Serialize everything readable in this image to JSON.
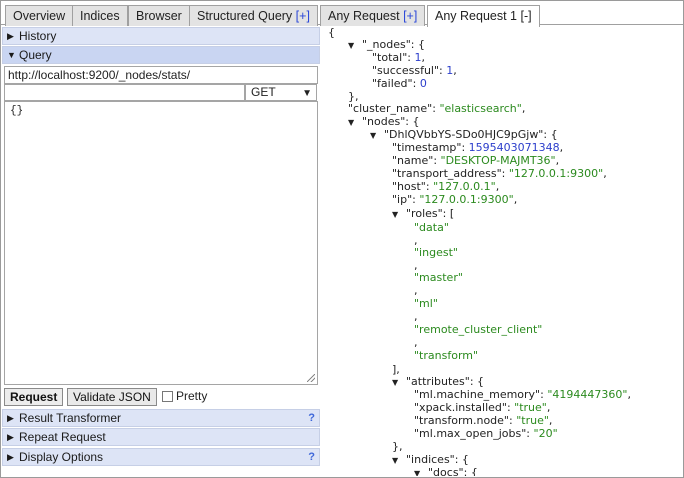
{
  "tabs": [
    {
      "label": "Overview",
      "plus": ""
    },
    {
      "label": "Indices",
      "plus": ""
    },
    {
      "label": "Browser",
      "plus": ""
    },
    {
      "label": "Structured Query",
      "plus": "[+]"
    },
    {
      "label": "Any Request",
      "plus": "[+]"
    },
    {
      "label": "Any Request 1",
      "plus": "[-]"
    }
  ],
  "left": {
    "history_label": "History",
    "query_label": "Query",
    "url_value": "http://localhost:9200/_nodes/stats/",
    "path_value": "",
    "method_value": "GET",
    "body_value": "{}",
    "request_button": "Request",
    "validate_button": "Validate JSON",
    "pretty_label": "Pretty",
    "sections": [
      {
        "label": "Result Transformer",
        "help": "?"
      },
      {
        "label": "Repeat Request",
        "help": ""
      },
      {
        "label": "Display Options",
        "help": "?"
      }
    ]
  },
  "json": {
    "open_brace": "{",
    "nodes_key": "\"_nodes\": {",
    "total_key": "\"total\": ",
    "total_val": "1",
    "successful_key": "\"successful\": ",
    "successful_val": "1",
    "failed_key": "\"failed\": ",
    "failed_val": "0",
    "close_obj": "},",
    "cluster_key": "\"cluster_name\": ",
    "cluster_val": "\"elasticsearch\"",
    "nodes2_key": "\"nodes\": {",
    "node_id_key": "\"DhlQVbbYS-SDo0HJC9pGjw\": {",
    "timestamp_key": "\"timestamp\": ",
    "timestamp_val": "1595403071348",
    "name_key": "\"name\": ",
    "name_val": "\"DESKTOP-MAJMT36\"",
    "transport_key": "\"transport_address\": ",
    "transport_val": "\"127.0.0.1:9300\"",
    "host_key": "\"host\": ",
    "host_val": "\"127.0.0.1\"",
    "ip_key": "\"ip\": ",
    "ip_val": "\"127.0.0.1:9300\"",
    "roles_key": "\"roles\": [",
    "roles": [
      "\"data\"",
      "\"ingest\"",
      "\"master\"",
      "\"ml\"",
      "\"remote_cluster_client\"",
      "\"transform\""
    ],
    "comma": ",",
    "close_arr": "],",
    "attributes_key": "\"attributes\": {",
    "mm_key": "\"ml.machine_memory\": ",
    "mm_val": "\"4194447360\"",
    "xpack_key": "\"xpack.installed\": ",
    "xpack_val": "\"true\"",
    "tnode_key": "\"transform.node\": ",
    "tnode_val": "\"true\"",
    "mlmax_key": "\"ml.max_open_jobs\": ",
    "mlmax_val": "\"20\"",
    "indices_key": "\"indices\": {",
    "docs_key": "\"docs\": {"
  }
}
